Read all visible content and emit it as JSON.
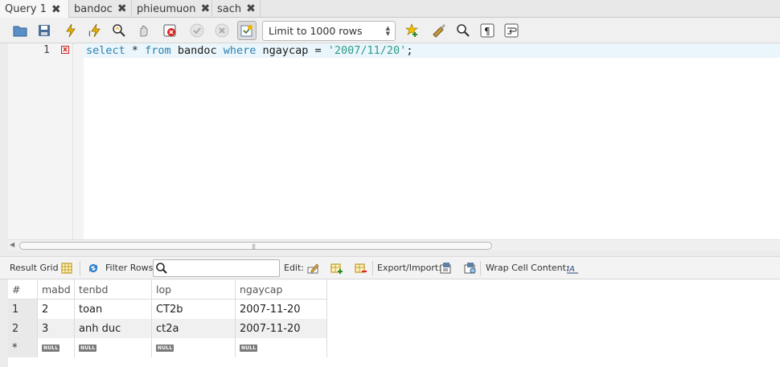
{
  "tabs": [
    {
      "label": "Query 1",
      "active": true
    },
    {
      "label": "bandoc",
      "active": false
    },
    {
      "label": "phieumuon",
      "active": false
    },
    {
      "label": "sach",
      "active": false
    }
  ],
  "toolbar": {
    "limit_select": "Limit to 1000 rows",
    "icons": [
      "open-folder-icon",
      "save-icon",
      "execute-icon",
      "execute-current-icon",
      "explain-icon",
      "stop-icon",
      "toggle-error-icon",
      "commit-icon",
      "rollback-icon",
      "autocommit-icon",
      "add-snippet-icon",
      "beautify-icon",
      "find-icon",
      "invisible-chars-icon",
      "wrap-lines-icon"
    ]
  },
  "editor": {
    "line_number": "1",
    "tokens": [
      {
        "text": "select",
        "type": "kw"
      },
      {
        "text": " * ",
        "type": "op"
      },
      {
        "text": "from",
        "type": "kw"
      },
      {
        "text": " bandoc ",
        "type": "id"
      },
      {
        "text": "where",
        "type": "kw"
      },
      {
        "text": " ngaycap = ",
        "type": "id"
      },
      {
        "text": "'2007/11/20'",
        "type": "str"
      },
      {
        "text": ";",
        "type": "op"
      }
    ]
  },
  "result_toolbar": {
    "result_grid_label": "Result Grid",
    "filter_rows_label": "Filter Rows:",
    "filter_value": "",
    "edit_label": "Edit:",
    "export_label": "Export/Import:",
    "wrap_label": "Wrap Cell Content:"
  },
  "grid": {
    "columns": [
      "#",
      "mabd",
      "tenbd",
      "lop",
      "ngaycap"
    ],
    "rows": [
      [
        "1",
        "2",
        "toan",
        "CT2b",
        "2007-11-20"
      ],
      [
        "2",
        "3",
        "anh duc",
        "ct2a",
        "2007-11-20"
      ]
    ],
    "new_row_marker": "*",
    "null_label": "NULL"
  },
  "colors": {
    "keyword": "#2a7fae",
    "string": "#2f9b86",
    "current_line": "#eaf6fb",
    "alt_row": "#f0f0f0"
  }
}
